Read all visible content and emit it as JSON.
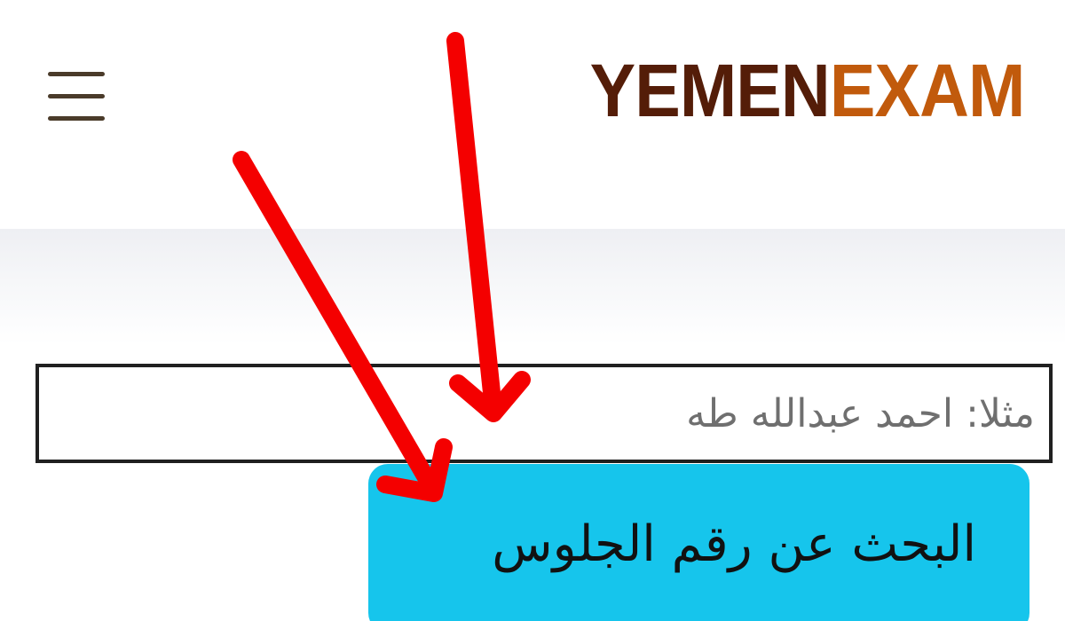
{
  "header": {
    "logo_part1": "YEMEN",
    "logo_part2": "EXAM",
    "menu_icon": "hamburger-menu-icon"
  },
  "search": {
    "placeholder": "مثلا: احمد عبدالله طه",
    "value": "",
    "button_label": "البحث عن رقم الجلوس"
  },
  "colors": {
    "logo_dark": "#541d08",
    "logo_orange": "#c15a0c",
    "button_bg": "#16c5ec",
    "annotation_arrow": "#f40000"
  },
  "annotations": {
    "arrow_icon": "red-arrow-icon"
  }
}
